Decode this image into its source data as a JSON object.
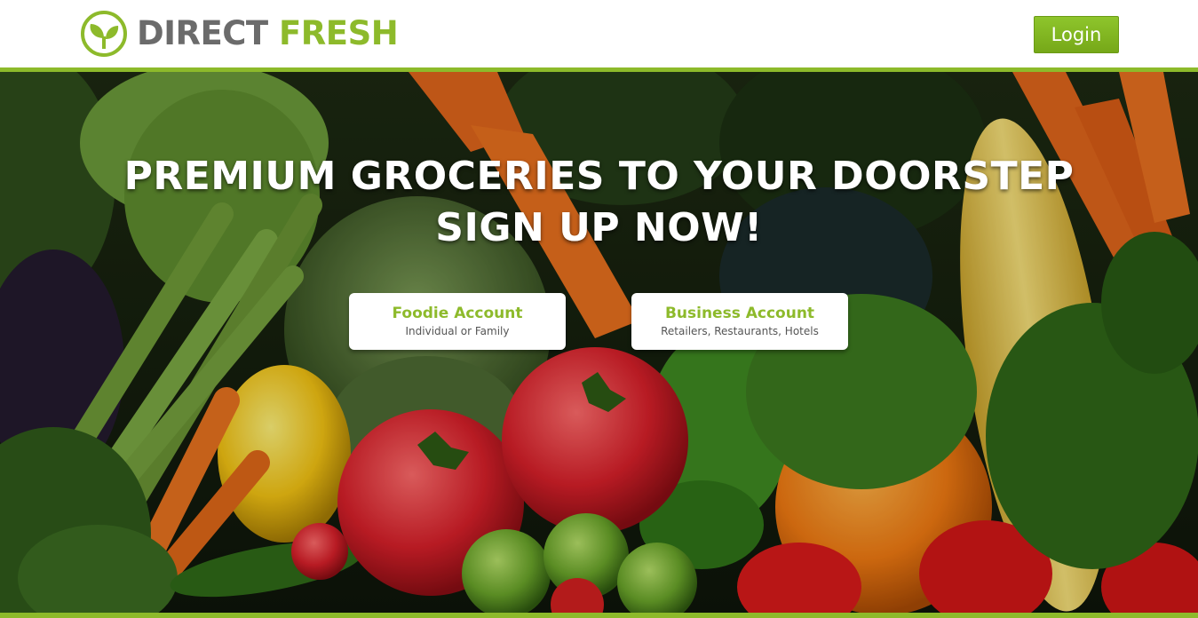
{
  "header": {
    "logo_word1": "DIRECT",
    "logo_word2": "FRESH",
    "login_label": "Login"
  },
  "hero": {
    "headline_line1": "PREMIUM GROCERIES TO YOUR DOORSTEP",
    "headline_line2": "SIGN UP NOW!",
    "accounts": [
      {
        "title": "Foodie Account",
        "subtitle": "Individual or Family"
      },
      {
        "title": "Business Account",
        "subtitle": "Retailers, Restaurants, Hotels"
      }
    ],
    "background_image": "vegetables-photo"
  },
  "colors": {
    "brand_green": "#8dba2b",
    "logo_gray": "#6b6b6b",
    "white": "#ffffff"
  },
  "icons": [
    "leaf-logo-icon"
  ]
}
